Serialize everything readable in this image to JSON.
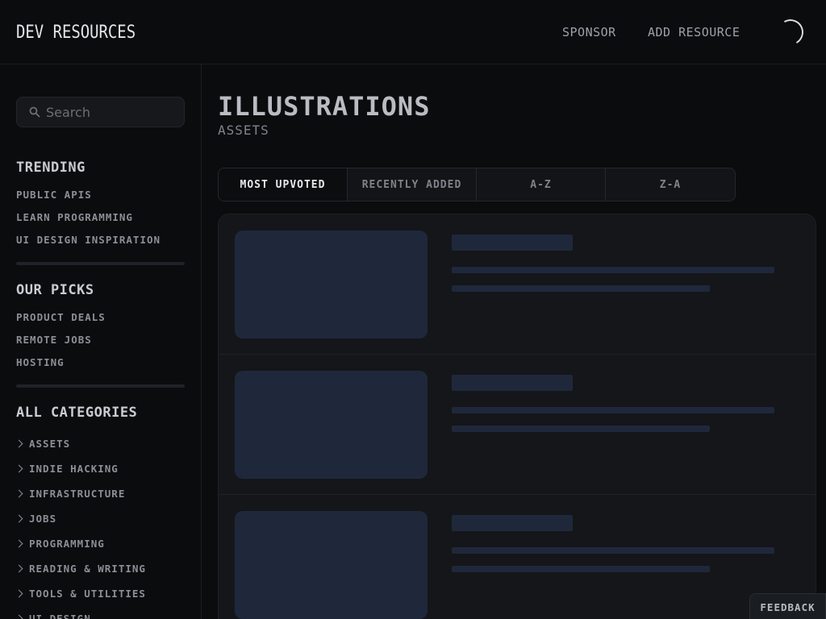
{
  "header": {
    "brand": "DEV RESOURCES",
    "nav": {
      "sponsor": "SPONSOR",
      "add_resource": "ADD RESOURCE"
    },
    "theme_toggle_icon": "moon-icon"
  },
  "sidebar": {
    "search": {
      "placeholder": "Search",
      "value": ""
    },
    "trending": {
      "title": "TRENDING",
      "items": [
        "PUBLIC APIS",
        "LEARN PROGRAMMING",
        "UI DESIGN INSPIRATION"
      ]
    },
    "our_picks": {
      "title": "OUR PICKS",
      "items": [
        "PRODUCT DEALS",
        "REMOTE JOBS",
        "HOSTING"
      ]
    },
    "all_categories": {
      "title": "ALL CATEGORIES",
      "items": [
        "ASSETS",
        "INDIE HACKING",
        "INFRASTRUCTURE",
        "JOBS",
        "PROGRAMMING",
        "READING & WRITING",
        "TOOLS & UTILITIES",
        "UI DESIGN"
      ]
    }
  },
  "main": {
    "title": "ILLUSTRATIONS",
    "subtitle": "ASSETS",
    "sort_tabs": [
      "MOST UPVOTED",
      "RECENTLY ADDED",
      "A-Z",
      "Z-A"
    ],
    "active_tab": "MOST UPVOTED"
  },
  "feedback_label": "FEEDBACK",
  "colors": {
    "background": "#0b0c0e",
    "panel": "#141619",
    "skeleton": "#1f283b",
    "text_primary": "#e3e5e8",
    "text_muted": "#8b8f96"
  }
}
